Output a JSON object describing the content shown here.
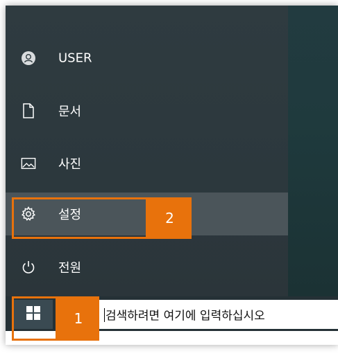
{
  "start_menu": {
    "items": [
      {
        "id": "user",
        "label": "USER",
        "icon": "user-avatar-icon"
      },
      {
        "id": "documents",
        "label": "문서",
        "icon": "document-icon"
      },
      {
        "id": "pictures",
        "label": "사진",
        "icon": "image-icon"
      },
      {
        "id": "settings",
        "label": "설정",
        "icon": "gear-icon",
        "highlighted": true
      },
      {
        "id": "power",
        "label": "전원",
        "icon": "power-icon"
      }
    ]
  },
  "taskbar": {
    "start_button_icon": "windows-logo-icon",
    "search_placeholder": "검색하려면 여기에 입력하십시오"
  },
  "callouts": [
    {
      "number": "1",
      "target": "start-button"
    },
    {
      "number": "2",
      "target": "settings"
    }
  ],
  "colors": {
    "callout": "#e8720c",
    "menu_bg": "#2f3b40",
    "menu_hover": "#4b555a",
    "desktop": "#1f3a3d",
    "start_button_bg": "#3a4a52"
  }
}
